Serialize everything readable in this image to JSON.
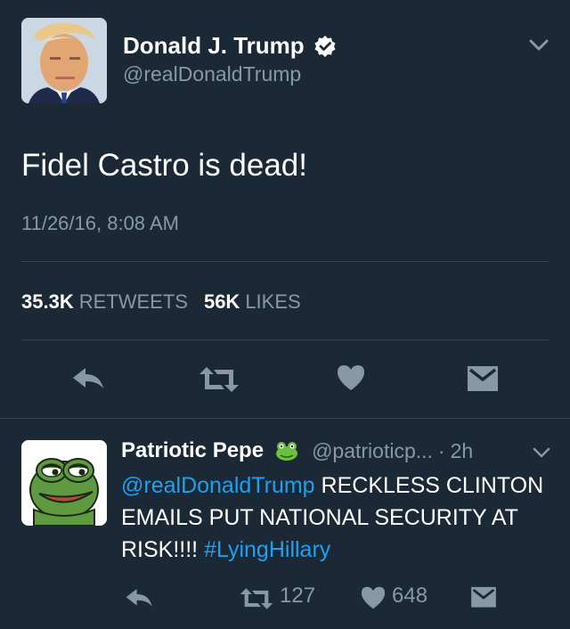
{
  "tweet": {
    "author_name": "Donald J. Trump",
    "handle": "@realDonaldTrump",
    "text": "Fidel Castro is dead!",
    "timestamp": "11/26/16, 8:08 AM",
    "stats": {
      "retweets_count": "35.3K",
      "retweets_label": "RETWEETS",
      "likes_count": "56K",
      "likes_label": "LIKES"
    },
    "actions": [
      "reply-icon",
      "retweet-icon",
      "heart-icon",
      "message-icon"
    ]
  },
  "reply": {
    "author_name": "Patriotic Pepe",
    "emoji": "frog-icon",
    "handle": "@patrioticp...",
    "separator": "·",
    "time": "2h",
    "mention": "@realDonaldTrump",
    "text": " RECKLESS CLINTON EMAILS PUT NATIONAL SECURITY AT RISK!!!! ",
    "hashtag": "#LyingHillary",
    "retweet_count": "127",
    "like_count": "648"
  },
  "colors": {
    "background": "#1b2836",
    "text": "#ffffff",
    "secondary": "#8899a6",
    "link": "#1da1f2",
    "divider": "#38444d"
  }
}
